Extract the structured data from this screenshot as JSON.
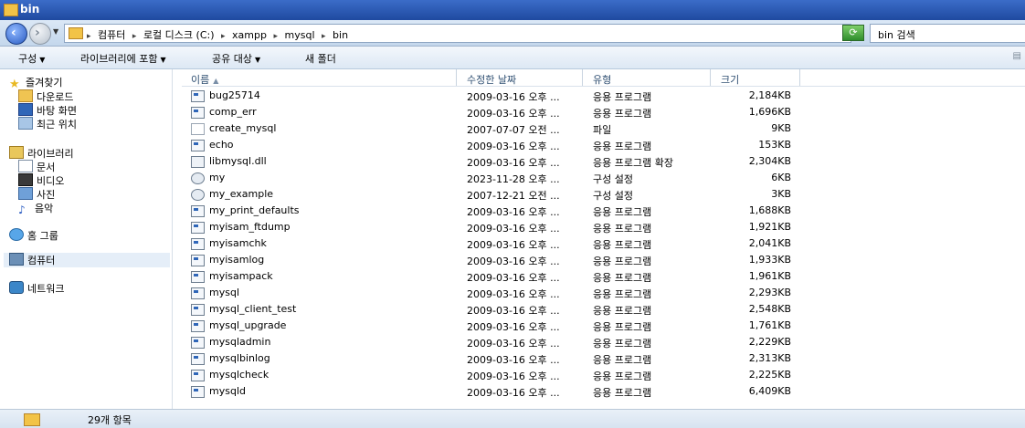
{
  "window": {
    "title": "bin"
  },
  "address": {
    "crumbs": [
      "컴퓨터",
      "로컬 디스크 (C:)",
      "xampp",
      "mysql",
      "bin"
    ],
    "separator": "▸",
    "search_placeholder": "bin 검색"
  },
  "toolbar": {
    "organize": "구성",
    "include_library": "라이브러리에 포함",
    "share": "공유 대상",
    "new_folder": "새 폴더"
  },
  "sidebar": {
    "favorites": "즐겨찾기",
    "downloads": "다운로드",
    "desktop": "바탕 화면",
    "recent": "최근 위치",
    "libraries": "라이브러리",
    "documents": "문서",
    "videos": "비디오",
    "pictures": "사진",
    "music": "음악",
    "homegroup": "홈 그룹",
    "computer": "컴퓨터",
    "network": "네트워크"
  },
  "columns": {
    "name": "이름",
    "date": "수정한 날짜",
    "type": "유형",
    "size": "크기"
  },
  "files": [
    {
      "icon": "app",
      "name": "bug25714",
      "date": "2009-03-16 오후 ...",
      "type": "응용 프로그램",
      "size": "2,184KB"
    },
    {
      "icon": "app",
      "name": "comp_err",
      "date": "2009-03-16 오후 ...",
      "type": "응용 프로그램",
      "size": "1,696KB"
    },
    {
      "icon": "file",
      "name": "create_mysql",
      "date": "2007-07-07 오전 ...",
      "type": "파일",
      "size": "9KB"
    },
    {
      "icon": "app",
      "name": "echo",
      "date": "2009-03-16 오후 ...",
      "type": "응용 프로그램",
      "size": "153KB"
    },
    {
      "icon": "dll",
      "name": "libmysql.dll",
      "date": "2009-03-16 오후 ...",
      "type": "응용 프로그램 확장",
      "size": "2,304KB"
    },
    {
      "icon": "cfg",
      "name": "my",
      "date": "2023-11-28 오후 ...",
      "type": "구성 설정",
      "size": "6KB"
    },
    {
      "icon": "cfg",
      "name": "my_example",
      "date": "2007-12-21 오전 ...",
      "type": "구성 설정",
      "size": "3KB"
    },
    {
      "icon": "app",
      "name": "my_print_defaults",
      "date": "2009-03-16 오후 ...",
      "type": "응용 프로그램",
      "size": "1,688KB"
    },
    {
      "icon": "app",
      "name": "myisam_ftdump",
      "date": "2009-03-16 오후 ...",
      "type": "응용 프로그램",
      "size": "1,921KB"
    },
    {
      "icon": "app",
      "name": "myisamchk",
      "date": "2009-03-16 오후 ...",
      "type": "응용 프로그램",
      "size": "2,041KB"
    },
    {
      "icon": "app",
      "name": "myisamlog",
      "date": "2009-03-16 오후 ...",
      "type": "응용 프로그램",
      "size": "1,933KB"
    },
    {
      "icon": "app",
      "name": "myisampack",
      "date": "2009-03-16 오후 ...",
      "type": "응용 프로그램",
      "size": "1,961KB"
    },
    {
      "icon": "app",
      "name": "mysql",
      "date": "2009-03-16 오후 ...",
      "type": "응용 프로그램",
      "size": "2,293KB"
    },
    {
      "icon": "app",
      "name": "mysql_client_test",
      "date": "2009-03-16 오후 ...",
      "type": "응용 프로그램",
      "size": "2,548KB"
    },
    {
      "icon": "app",
      "name": "mysql_upgrade",
      "date": "2009-03-16 오후 ...",
      "type": "응용 프로그램",
      "size": "1,761KB"
    },
    {
      "icon": "app",
      "name": "mysqladmin",
      "date": "2009-03-16 오후 ...",
      "type": "응용 프로그램",
      "size": "2,229KB"
    },
    {
      "icon": "app",
      "name": "mysqlbinlog",
      "date": "2009-03-16 오후 ...",
      "type": "응용 프로그램",
      "size": "2,313KB"
    },
    {
      "icon": "app",
      "name": "mysqlcheck",
      "date": "2009-03-16 오후 ...",
      "type": "응용 프로그램",
      "size": "2,225KB"
    },
    {
      "icon": "app",
      "name": "mysqld",
      "date": "2009-03-16 오후 ...",
      "type": "응용 프로그램",
      "size": "6,409KB"
    }
  ],
  "status": {
    "count": "29개 항목"
  }
}
